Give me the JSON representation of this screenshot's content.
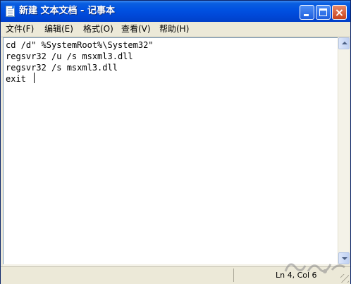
{
  "window": {
    "title": "新建 文本文档 - 记事本",
    "buttons": {
      "minimize": "minimize",
      "maximize": "maximize",
      "close": "×"
    }
  },
  "menu": [
    {
      "label": "文件(F)"
    },
    {
      "label": "编辑(E)"
    },
    {
      "label": "格式(O)"
    },
    {
      "label": "查看(V)"
    },
    {
      "label": "帮助(H)"
    }
  ],
  "editor": {
    "content": "cd /d\" %SystemRoot%\\System32\"\nregsvr32 /u /s msxml3.dll\nregsvr32 /s msxml3.dll\nexit"
  },
  "status": {
    "position": "Ln 4, Col 6"
  },
  "colors": {
    "titlebar": "#0050e0",
    "close_button": "#c7421c",
    "face": "#ece9d8",
    "scroll_track": "#f4f2e8"
  },
  "icons": [
    "notepad-icon",
    "minimize-icon",
    "maximize-icon",
    "close-icon",
    "scroll-up-arrow-icon",
    "scroll-down-arrow-icon",
    "resize-grip-icon"
  ]
}
